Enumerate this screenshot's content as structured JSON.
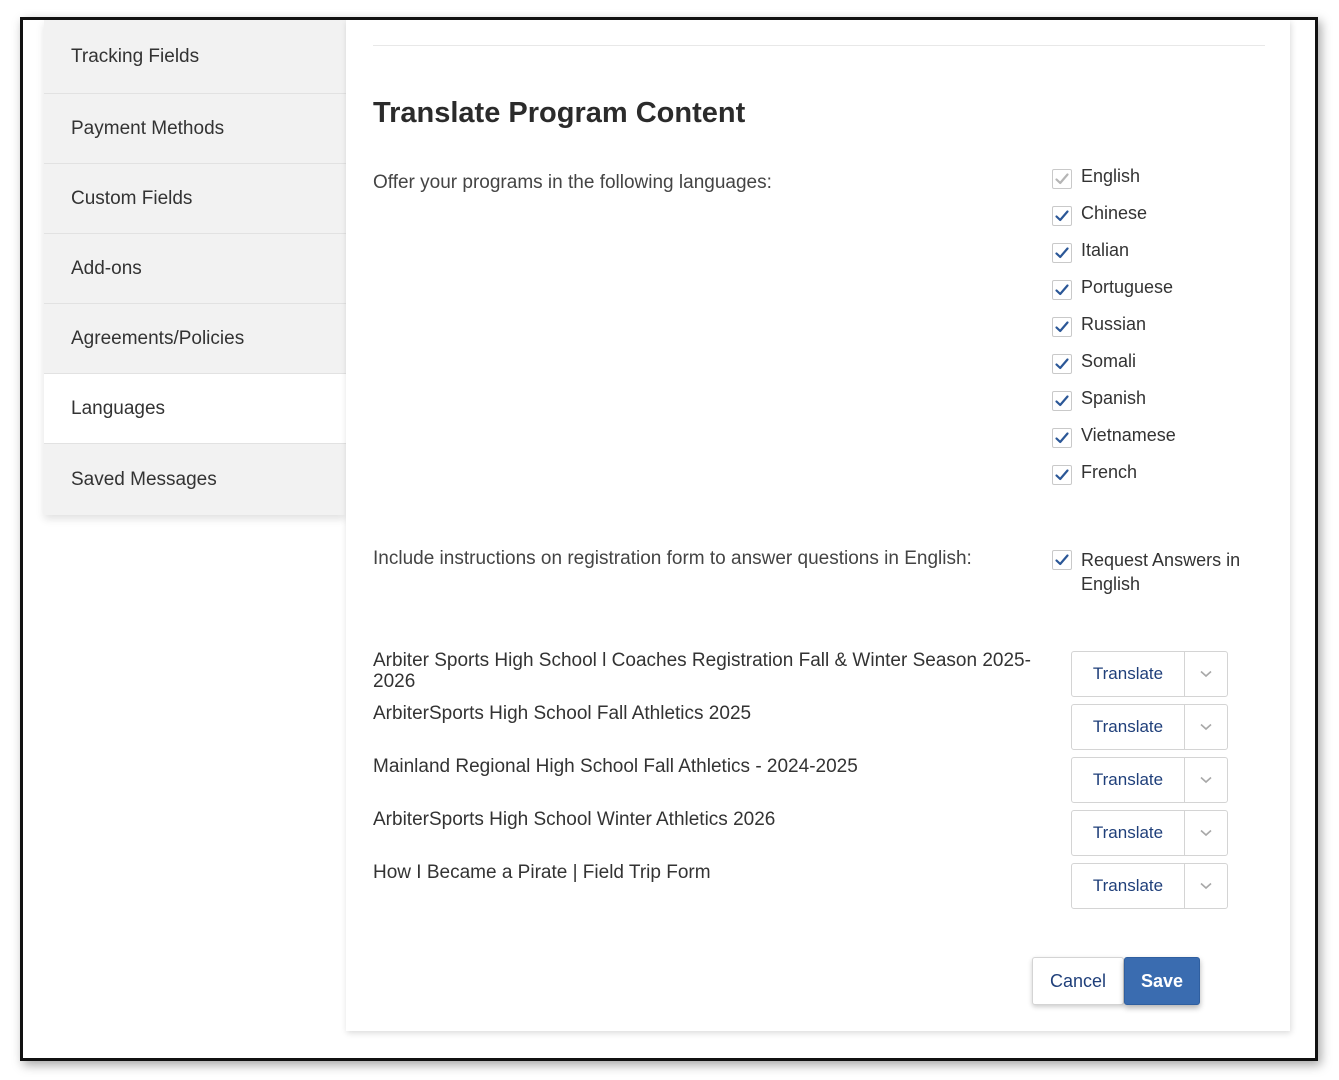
{
  "sidebar": {
    "items": [
      {
        "label": "Tracking Fields"
      },
      {
        "label": "Payment Methods"
      },
      {
        "label": "Custom Fields"
      },
      {
        "label": "Add-ons"
      },
      {
        "label": "Agreements/Policies"
      },
      {
        "label": "Languages",
        "active": true
      },
      {
        "label": "Saved Messages"
      }
    ]
  },
  "main": {
    "title": "Translate Program Content",
    "languages_prompt": "Offer your programs in the following languages:",
    "languages": [
      {
        "label": "English",
        "checked": true,
        "disabled": true
      },
      {
        "label": "Chinese",
        "checked": true
      },
      {
        "label": "Italian",
        "checked": true
      },
      {
        "label": "Portuguese",
        "checked": true
      },
      {
        "label": "Russian",
        "checked": true
      },
      {
        "label": "Somali",
        "checked": true
      },
      {
        "label": "Spanish",
        "checked": true
      },
      {
        "label": "Vietnamese",
        "checked": true
      },
      {
        "label": "French",
        "checked": true
      }
    ],
    "instructions_prompt": "Include instructions on registration form to answer questions in English:",
    "request_answers_label": "Request Answers in English",
    "programs": [
      {
        "name": "Arbiter Sports High School l Coaches Registration Fall & Winter Season 2025-2026",
        "action": "Translate"
      },
      {
        "name": "ArbiterSports High School Fall Athletics 2025",
        "action": "Translate"
      },
      {
        "name": "Mainland Regional High School Fall Athletics - 2024-2025",
        "action": "Translate"
      },
      {
        "name": "ArbiterSports High School Winter Athletics 2026",
        "action": "Translate"
      },
      {
        "name": "How I Became a Pirate | Field Trip Form",
        "action": "Translate"
      }
    ],
    "cancel_label": "Cancel",
    "save_label": "Save"
  },
  "colors": {
    "accent": "#3a6cb0",
    "link": "#1f3f7a",
    "check": "#2b5797",
    "check_disabled": "#b5b5b5",
    "sidebar_bg": "#f2f2f2"
  },
  "icons": {
    "check": "check-icon",
    "dropdown": "chevron-down-icon"
  }
}
